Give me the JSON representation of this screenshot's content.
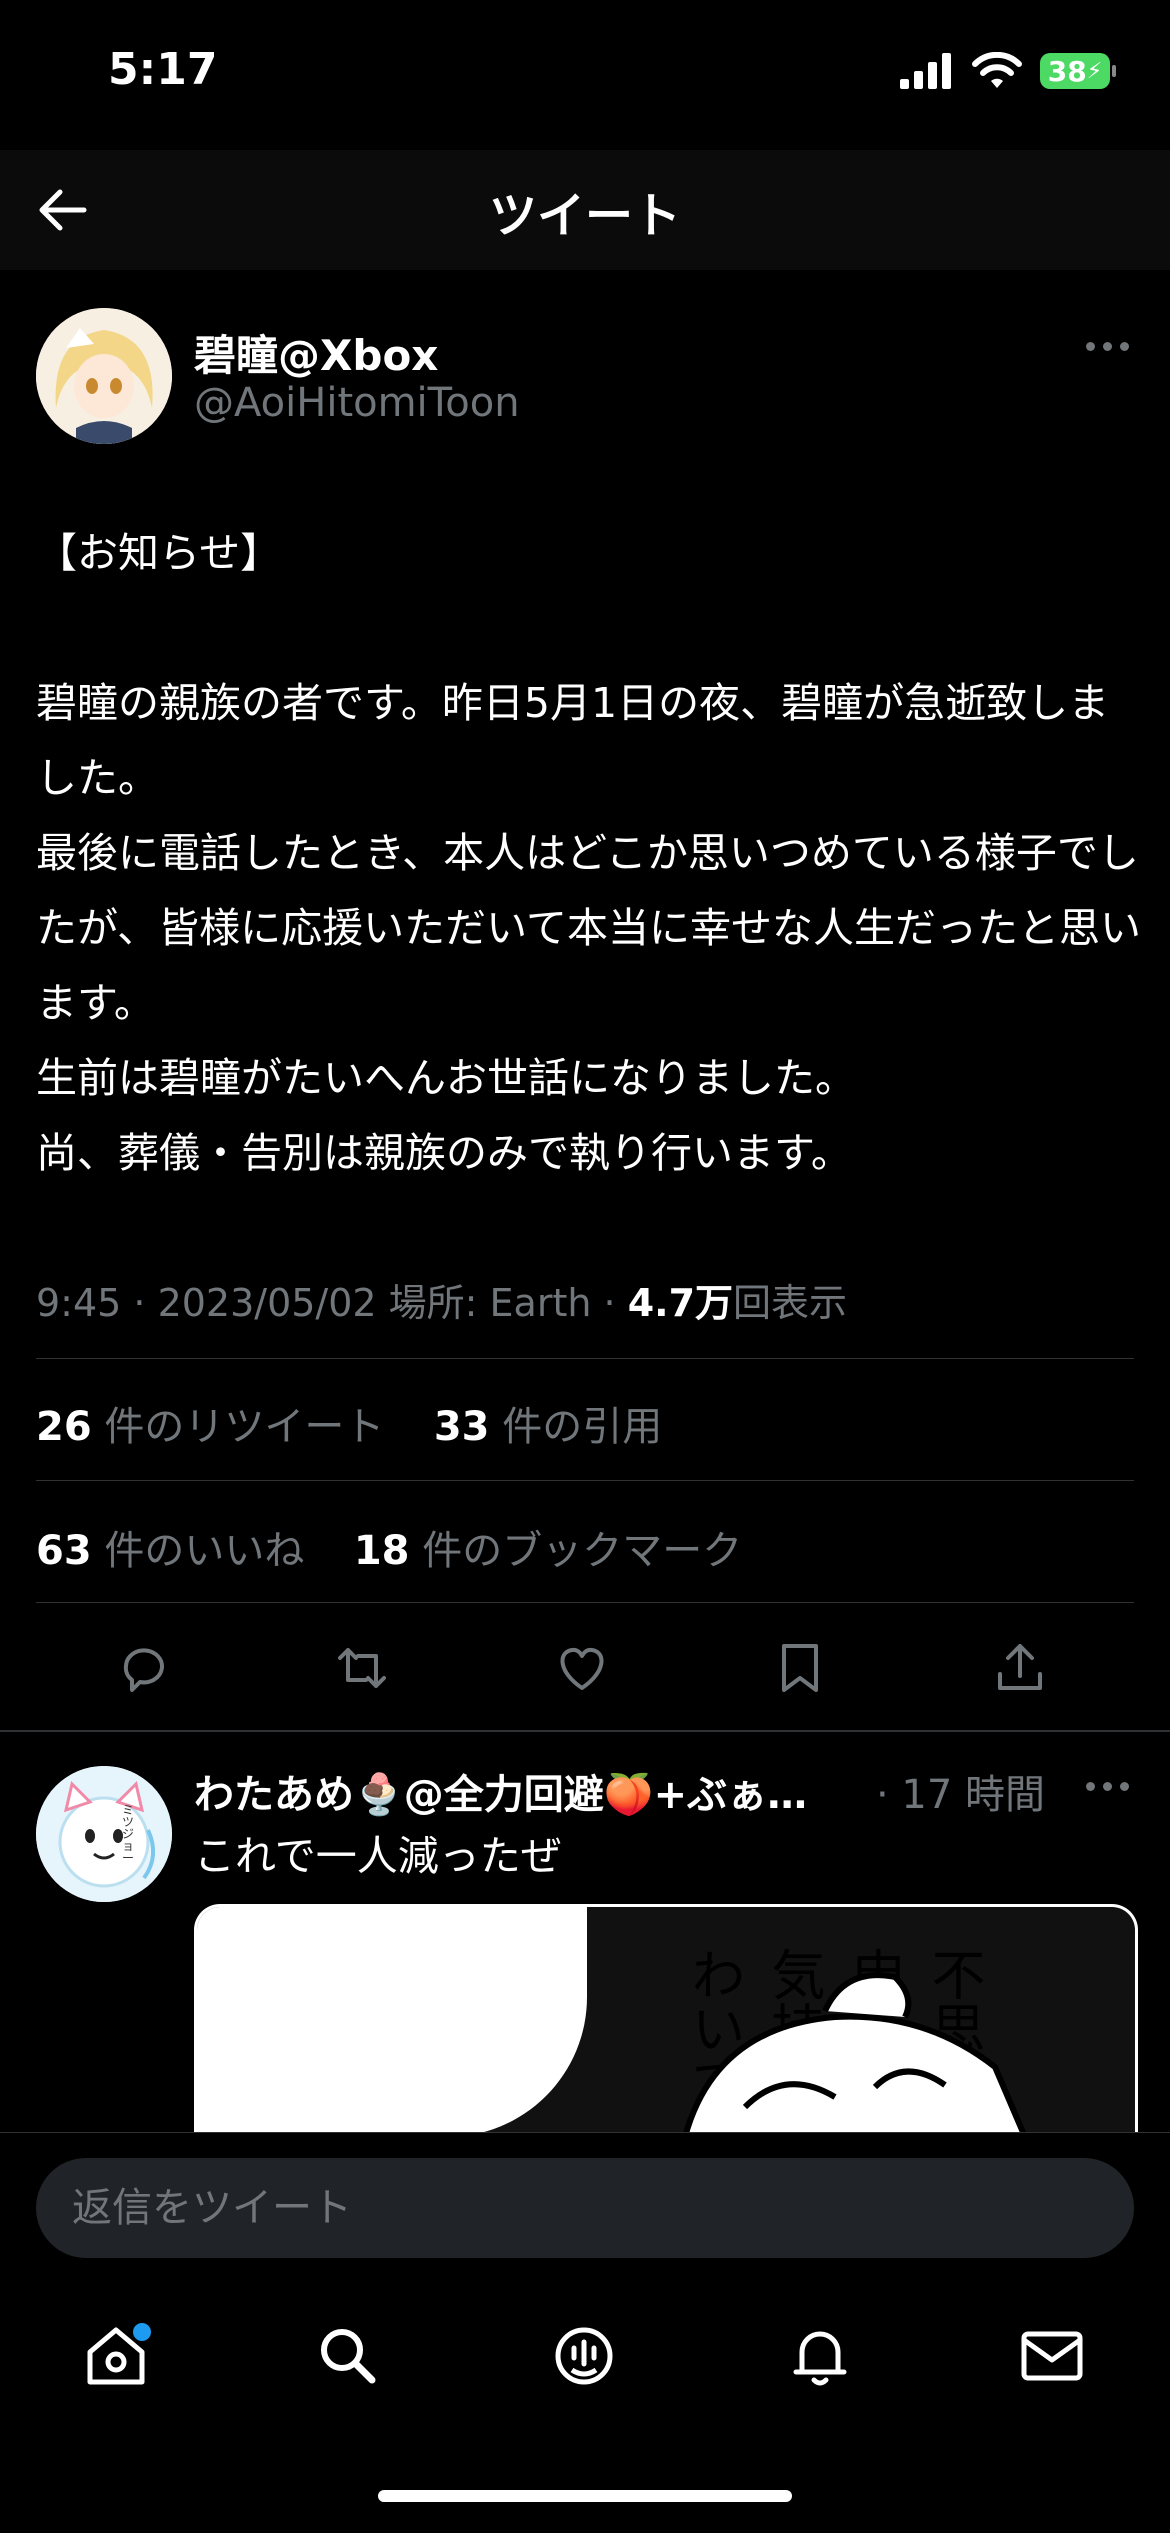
{
  "status_bar": {
    "time": "5:17",
    "battery": "38"
  },
  "header": {
    "title": "ツイート"
  },
  "tweet": {
    "author_name": "碧瞳@Xbox",
    "author_handle": "@AoiHitomiToon",
    "body": "【お知らせ】\n\n碧瞳の親族の者です。昨日5月1日の夜、碧瞳が急逝致しました。\n最後に電話したとき、本人はどこか思いつめている様子でしたが、皆様に応援いただいて本当に幸せな人生だったと思います。\n生前は碧瞳がたいへんお世話になりました。\n尚、葬儀・告別は親族のみで執り行います。",
    "meta_prefix": "9:45 · 2023/05/02 場所: Earth · ",
    "views_count": "4.7万",
    "views_label": "回表示",
    "retweets_count": "26",
    "retweets_label": "件のリツイート",
    "quotes_count": "33",
    "quotes_label": "件の引用",
    "likes_count": "63",
    "likes_label": "件のいいね",
    "bookmarks_count": "18",
    "bookmarks_label": "件のブックマーク"
  },
  "reply": {
    "author_name": "わたあめ🍨@全力回避🍑+ぶぁ…",
    "time": "· 17 時間",
    "text": "これで一人減ったぜ",
    "avatar_text": "ミツジョー",
    "manga_lines": [
      "不思議",
      "申し訳",
      "気持ち",
      "わいて"
    ]
  },
  "composer": {
    "placeholder": "返信をツイート"
  },
  "colors": {
    "accent": "#1d9bf0",
    "muted": "#71767b",
    "divider": "#2f3336"
  }
}
